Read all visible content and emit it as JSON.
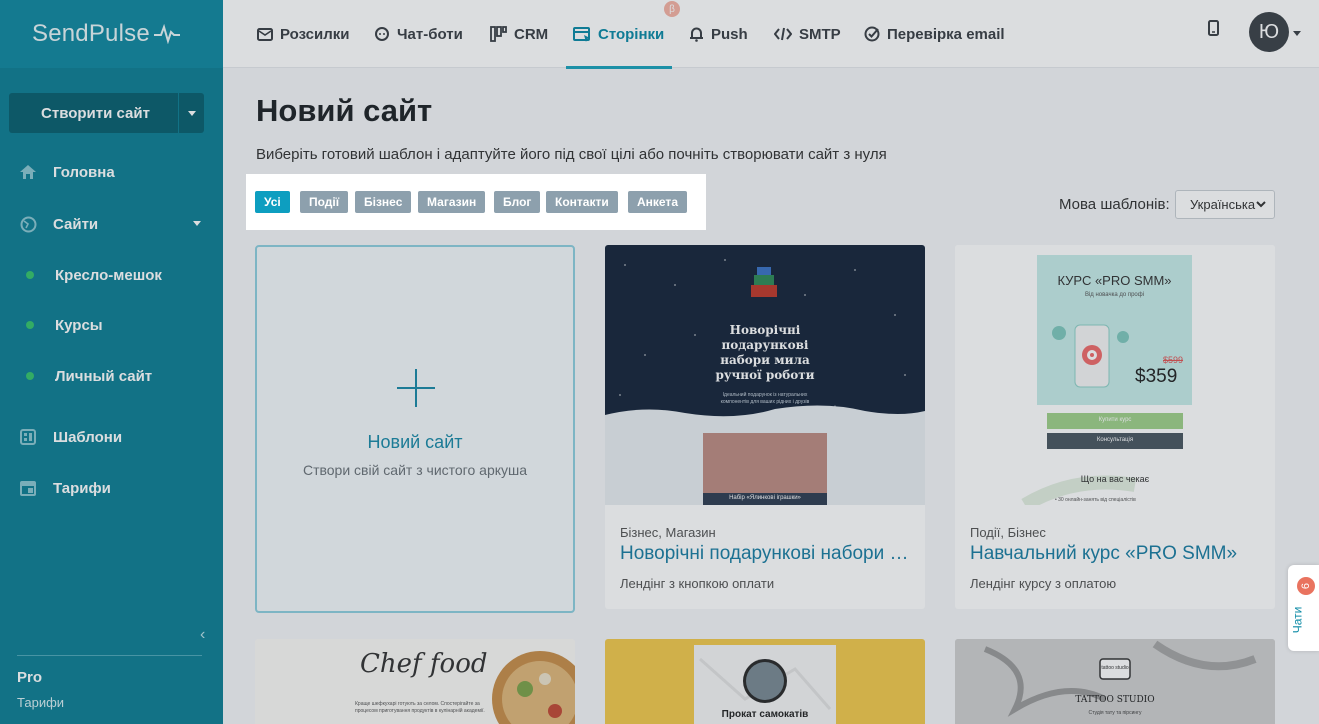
{
  "sidebar": {
    "logo": "SendPulse",
    "create_button": "Створити сайт",
    "items": [
      {
        "label": "Головна"
      },
      {
        "label": "Сайти"
      },
      {
        "label": "Шаблони"
      },
      {
        "label": "Тарифи"
      }
    ],
    "sites": [
      {
        "label": "Кресло-мешок"
      },
      {
        "label": "Курсы"
      },
      {
        "label": "Личный сайт"
      }
    ],
    "plan": "Pro",
    "plan_link": "Тарифи"
  },
  "topnav": {
    "items": [
      {
        "label": "Розсилки",
        "icon": "envelope-icon"
      },
      {
        "label": "Чат-боти",
        "icon": "chat-icon"
      },
      {
        "label": "CRM",
        "icon": "crm-icon"
      },
      {
        "label": "Сторінки",
        "icon": "pages-icon"
      },
      {
        "label": "Push",
        "icon": "bell-icon"
      },
      {
        "label": "SMTP",
        "icon": "code-icon"
      },
      {
        "label": "Перевірка email",
        "icon": "check-icon"
      }
    ],
    "beta": "β",
    "avatar": "Ю"
  },
  "main": {
    "title": "Новий сайт",
    "subtitle": "Виберіть готовий шаблон і адаптуйте його під свої цілі або почніть створювати сайт з нуля",
    "filters": [
      "Усі",
      "Події",
      "Бізнес",
      "Магазин",
      "Блог",
      "Контакти",
      "Анкета"
    ],
    "language_label": "Мова шаблонів:",
    "language_value": "Українська",
    "new_card": {
      "title": "Новий сайт",
      "subtitle": "Створи свій сайт з чистого аркуша"
    },
    "templates": [
      {
        "tags": "Бізнес, Магазин",
        "title": "Новорічні подарункові набори мила ручної роботи",
        "desc": "Лендінг з кнопкою оплати",
        "thumb_text": "Новорічні подарункові набори мила ручної роботи",
        "thumb_small": "Ідеальний подарунок із натуральних компонентів для ваших рідних і друзів",
        "thumb_caption": "Набір «Ялинкові іграшки»"
      },
      {
        "tags": "Події, Бізнес",
        "title": "Навчальний курс «PRO SMM»",
        "desc": "Лендінг курсу з оплатою",
        "thumb_title": "КУРС «PRO SMM»",
        "thumb_sub": "Від новачка до профі",
        "old_price": "$599",
        "price": "$359",
        "btn1": "Купити курс",
        "btn2": "Консультація",
        "section": "Що на вас чекає",
        "bullet": "• 30 онлайн-занять від спеціалістів"
      }
    ],
    "bottom_cards": [
      {
        "text": "Chef food",
        "small": "Краще шефкухарі готують за селом. Спостерігайте за процесом приготування продуктів в кулінарній академії."
      },
      {
        "text": "Прокат самокатів"
      },
      {
        "text": "TATTOO STUDIO",
        "small": "Студія тату та пірсингу",
        "badge": "tattoo studio"
      }
    ]
  },
  "chat": {
    "label": "Чати",
    "count": "6"
  },
  "colors": {
    "sidebar": "#0e7f94",
    "accent": "#0a8aa6",
    "active_chip": "#0d9ec0"
  }
}
